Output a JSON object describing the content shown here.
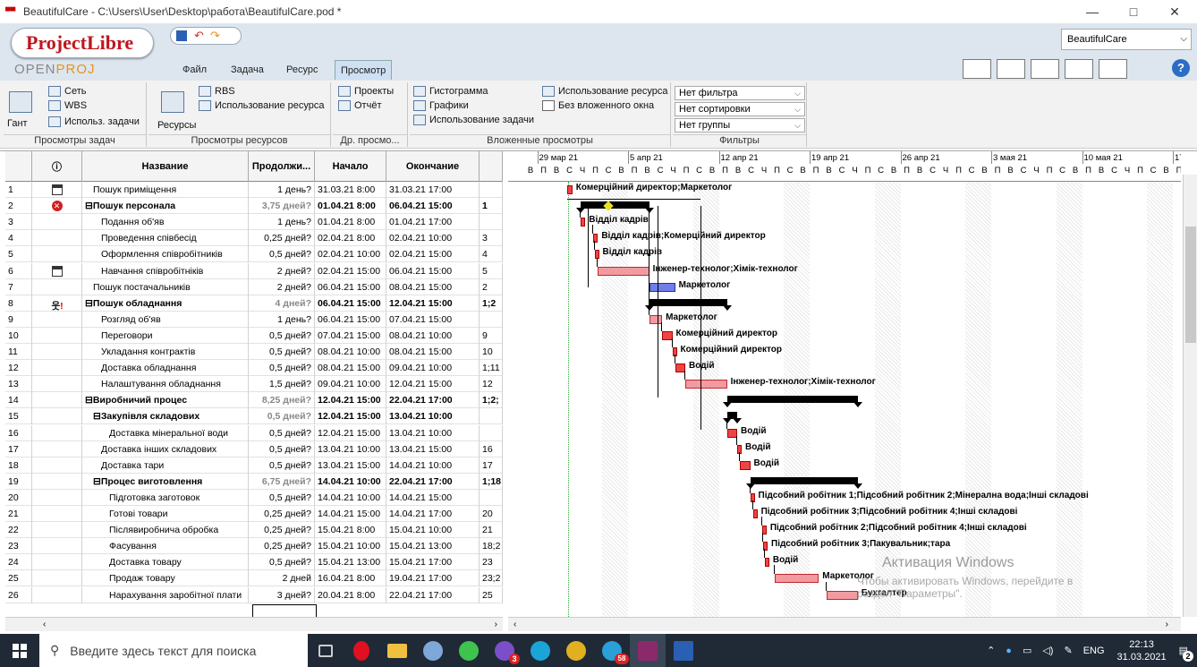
{
  "window": {
    "title": "BeautifulCare - C:\\Users\\User\\Desktop\\работа\\BeautifulCare.pod *",
    "minimize": "—",
    "maximize": "□",
    "close": "✕"
  },
  "logo": {
    "name": "ProjectLibre",
    "sub_a": "OPEN",
    "sub_b": "PROJ"
  },
  "menu": {
    "file": "Файл",
    "task": "Задача",
    "resource": "Ресурс",
    "view": "Просмотр"
  },
  "project_combo": "BeautifulCare",
  "ribbon": {
    "gantt": "Гант",
    "network": "Сеть",
    "wbs": "WBS",
    "task_usage": "Использ. задачи",
    "task_views": "Просмотры задач",
    "resources": "Ресурсы",
    "rbs": "RBS",
    "resource_usage": "Использование ресурса",
    "resource_views": "Просмотры ресурсов",
    "projects": "Проекты",
    "report": "Отчёт",
    "other_views": "Др. просмо...",
    "histogram": "Гистограмма",
    "charts": "Графики",
    "task_usage2": "Использование задачи",
    "resource_usage2": "Использование ресурса",
    "no_sub": "Без вложенного окна",
    "sub_views": "Вложенные просмотры",
    "filter": "Нет фильтра",
    "sort": "Нет сортировки",
    "group": "Нет группы",
    "filters": "Фильтры"
  },
  "columns": {
    "indicators": "ⓘ",
    "name": "Название",
    "duration": "Продолжи...",
    "start": "Начало",
    "finish": "Окончание"
  },
  "rows": [
    {
      "id": "1",
      "ind": "cal",
      "name": "Пошук приміщення",
      "lvl": 1,
      "sum": false,
      "dur": "1 день?",
      "start": "31.03.21 8:00",
      "fin": "31.03.21 17:00",
      "pred": ""
    },
    {
      "id": "2",
      "ind": "err",
      "name": "Пошук персонала",
      "lvl": 0,
      "sum": true,
      "dur": "3,75 дней?",
      "start": "01.04.21 8:00",
      "fin": "06.04.21 15:00",
      "pred": "1"
    },
    {
      "id": "3",
      "ind": "",
      "name": "Подання об'яв",
      "lvl": 2,
      "sum": false,
      "dur": "1 день?",
      "start": "01.04.21 8:00",
      "fin": "01.04.21 17:00",
      "pred": ""
    },
    {
      "id": "4",
      "ind": "",
      "name": "Проведення співбесід",
      "lvl": 2,
      "sum": false,
      "dur": "0,25 дней?",
      "start": "02.04.21 8:00",
      "fin": "02.04.21 10:00",
      "pred": "3"
    },
    {
      "id": "5",
      "ind": "",
      "name": "Оформлення співробітників",
      "lvl": 2,
      "sum": false,
      "dur": "0,5 дней?",
      "start": "02.04.21 10:00",
      "fin": "02.04.21 15:00",
      "pred": "4"
    },
    {
      "id": "6",
      "ind": "cal",
      "name": "Навчання співробітніків",
      "lvl": 2,
      "sum": false,
      "dur": "2 дней?",
      "start": "02.04.21 15:00",
      "fin": "06.04.21 15:00",
      "pred": "5"
    },
    {
      "id": "7",
      "ind": "",
      "name": "Пошук постачальників",
      "lvl": 1,
      "sum": false,
      "dur": "2 дней?",
      "start": "06.04.21 15:00",
      "fin": "08.04.21 15:00",
      "pred": "2"
    },
    {
      "id": "8",
      "ind": "warn",
      "name": "Пошук обладнання",
      "lvl": 0,
      "sum": true,
      "dur": "4 дней?",
      "start": "06.04.21 15:00",
      "fin": "12.04.21 15:00",
      "pred": "1;2"
    },
    {
      "id": "9",
      "ind": "",
      "name": "Розгляд об'яв",
      "lvl": 2,
      "sum": false,
      "dur": "1 день?",
      "start": "06.04.21 15:00",
      "fin": "07.04.21 15:00",
      "pred": ""
    },
    {
      "id": "10",
      "ind": "",
      "name": "Переговори",
      "lvl": 2,
      "sum": false,
      "dur": "0,5 дней?",
      "start": "07.04.21 15:00",
      "fin": "08.04.21 10:00",
      "pred": "9"
    },
    {
      "id": "11",
      "ind": "",
      "name": "Укладання контрактів",
      "lvl": 2,
      "sum": false,
      "dur": "0,5 дней?",
      "start": "08.04.21 10:00",
      "fin": "08.04.21 15:00",
      "pred": "10"
    },
    {
      "id": "12",
      "ind": "",
      "name": "Доставка обладнання",
      "lvl": 2,
      "sum": false,
      "dur": "0,5 дней?",
      "start": "08.04.21 15:00",
      "fin": "09.04.21 10:00",
      "pred": "1;11"
    },
    {
      "id": "13",
      "ind": "",
      "name": "Налаштування обладнання",
      "lvl": 2,
      "sum": false,
      "dur": "1,5 дней?",
      "start": "09.04.21 10:00",
      "fin": "12.04.21 15:00",
      "pred": "12"
    },
    {
      "id": "14",
      "ind": "",
      "name": "Виробничий процес",
      "lvl": 0,
      "sum": true,
      "dur": "8,25 дней?",
      "start": "12.04.21 15:00",
      "fin": "22.04.21 17:00",
      "pred": "1;2;"
    },
    {
      "id": "15",
      "ind": "",
      "name": "Закупівля складових",
      "lvl": 1,
      "sum": true,
      "dur": "0,5 дней?",
      "start": "12.04.21 15:00",
      "fin": "13.04.21 10:00",
      "pred": ""
    },
    {
      "id": "16",
      "ind": "",
      "name": "Доставка мінеральної води",
      "lvl": 3,
      "sum": false,
      "dur": "0,5 дней?",
      "start": "12.04.21 15:00",
      "fin": "13.04.21 10:00",
      "pred": ""
    },
    {
      "id": "17",
      "ind": "",
      "name": "Доставка інших складових",
      "lvl": 2,
      "sum": false,
      "dur": "0,5 дней?",
      "start": "13.04.21 10:00",
      "fin": "13.04.21 15:00",
      "pred": "16"
    },
    {
      "id": "18",
      "ind": "",
      "name": "Доставка тари",
      "lvl": 2,
      "sum": false,
      "dur": "0,5 дней?",
      "start": "13.04.21 15:00",
      "fin": "14.04.21 10:00",
      "pred": "17"
    },
    {
      "id": "19",
      "ind": "",
      "name": "Процес виготовлення",
      "lvl": 1,
      "sum": true,
      "dur": "6,75 дней?",
      "start": "14.04.21 10:00",
      "fin": "22.04.21 17:00",
      "pred": "1;18"
    },
    {
      "id": "20",
      "ind": "",
      "name": "Підготовка заготовок",
      "lvl": 3,
      "sum": false,
      "dur": "0,5 дней?",
      "start": "14.04.21 10:00",
      "fin": "14.04.21 15:00",
      "pred": ""
    },
    {
      "id": "21",
      "ind": "",
      "name": "Готові товари",
      "lvl": 3,
      "sum": false,
      "dur": "0,25 дней?",
      "start": "14.04.21 15:00",
      "fin": "14.04.21 17:00",
      "pred": "20"
    },
    {
      "id": "22",
      "ind": "",
      "name": "Післявиробнича обробка",
      "lvl": 3,
      "sum": false,
      "dur": "0,25 дней?",
      "start": "15.04.21 8:00",
      "fin": "15.04.21 10:00",
      "pred": "21"
    },
    {
      "id": "23",
      "ind": "",
      "name": "Фасування",
      "lvl": 3,
      "sum": false,
      "dur": "0,25 дней?",
      "start": "15.04.21 10:00",
      "fin": "15.04.21 13:00",
      "pred": "18;2"
    },
    {
      "id": "24",
      "ind": "",
      "name": "Доставка товару",
      "lvl": 3,
      "sum": false,
      "dur": "0,5 дней?",
      "start": "15.04.21 13:00",
      "fin": "15.04.21 17:00",
      "pred": "23"
    },
    {
      "id": "25",
      "ind": "",
      "name": "Продаж товару",
      "lvl": 3,
      "sum": false,
      "dur": "2 дней",
      "start": "16.04.21 8:00",
      "fin": "19.04.21 17:00",
      "pred": "23;2"
    },
    {
      "id": "26",
      "ind": "",
      "name": "Нарахування заробітної плати",
      "lvl": 3,
      "sum": false,
      "dur": "3 дней?",
      "start": "20.04.21 8:00",
      "fin": "22.04.21 17:00",
      "pred": "25"
    }
  ],
  "gantt": {
    "weeks": [
      "29 мар 21",
      "5 апр 21",
      "12 апр 21",
      "19 апр 21",
      "26 апр 21",
      "3 мая 21",
      "10 мая 21",
      "17"
    ],
    "days": [
      "В",
      "П",
      "В",
      "С",
      "Ч",
      "П",
      "С"
    ],
    "labels": {
      "1": "Комерційний директор;Маркетолог",
      "3": "Відділ кадрів",
      "4": "Відділ кадрів;Комерційний директор",
      "5": "Відділ кадрів",
      "6": "Інженер-технолог;Хімік-технолог",
      "7": "Маркетолог",
      "9": "Маркетолог",
      "10": "Комерційний директор",
      "11": "Комерційний директор",
      "12": "Водій",
      "13": "Інженер-технолог;Хімік-технолог",
      "16": "Водій",
      "17": "Водій",
      "18": "Водій",
      "20": "Підсобний робітник 1;Підсобний робітник 2;Мінерална вода;Інші складові",
      "21": "Підсобний робітник 3;Підсобний робітник 4;Інші складові",
      "22": "Підсобний робітник 2;Підсобний робітник 4;Інші складові",
      "23": "Підсобний робітник 3;Пакувальник;тара",
      "24": "Водій",
      "25": "Маркетолог",
      "26": "Бухгалтер"
    }
  },
  "watermark": {
    "line1": "Активация Windows",
    "line2": "Чтобы активировать Windows, перейдите в",
    "line3": "раздел \"Параметры\"."
  },
  "taskbar": {
    "search_placeholder": "Введите здесь текст для поиска",
    "lang": "ENG",
    "time": "22:13",
    "date": "31.03.2021",
    "badge1": "3",
    "badge2": "58",
    "notif": "2"
  }
}
